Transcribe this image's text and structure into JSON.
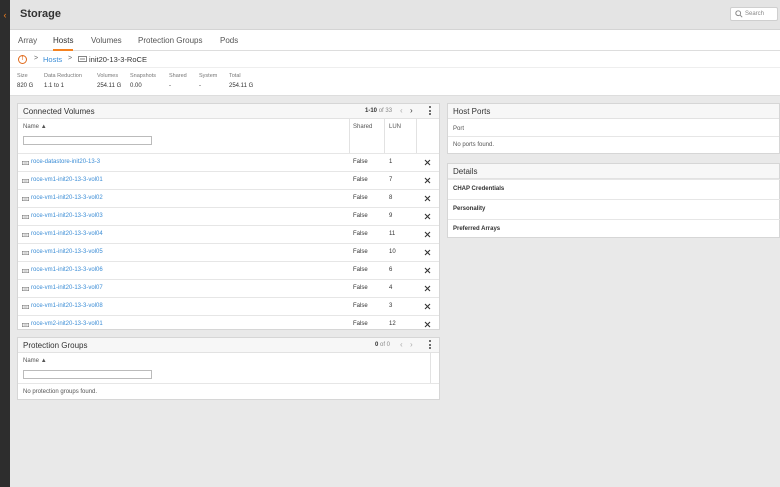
{
  "app": {
    "title": "Storage",
    "search_placeholder": "Search"
  },
  "tabs": [
    "Array",
    "Hosts",
    "Volumes",
    "Protection Groups",
    "Pods"
  ],
  "breadcrumb": {
    "sep": ">",
    "link": "Hosts",
    "current": "init20-13-3-RoCE"
  },
  "stats": [
    {
      "label": "Size",
      "value": "820 G"
    },
    {
      "label": "Data Reduction",
      "value": "1.1 to 1"
    },
    {
      "label": "Volumes",
      "value": "254.11 G"
    },
    {
      "label": "Snapshots",
      "value": "0.00"
    },
    {
      "label": "Shared",
      "value": "-"
    },
    {
      "label": "System",
      "value": "-"
    },
    {
      "label": "Total",
      "value": "254.11 G"
    }
  ],
  "connected_volumes": {
    "title": "Connected Volumes",
    "pager_range": "1-10",
    "pager_total": "of 33",
    "columns": {
      "name": "Name",
      "shared": "Shared",
      "lun": "LUN"
    },
    "rows": [
      {
        "name": "roce-datastore-init20-13-3",
        "shared": "False",
        "lun": "1"
      },
      {
        "name": "roce-vm1-init20-13-3-vol01",
        "shared": "False",
        "lun": "7"
      },
      {
        "name": "roce-vm1-init20-13-3-vol02",
        "shared": "False",
        "lun": "8"
      },
      {
        "name": "roce-vm1-init20-13-3-vol03",
        "shared": "False",
        "lun": "9"
      },
      {
        "name": "roce-vm1-init20-13-3-vol04",
        "shared": "False",
        "lun": "11"
      },
      {
        "name": "roce-vm1-init20-13-3-vol05",
        "shared": "False",
        "lun": "10"
      },
      {
        "name": "roce-vm1-init20-13-3-vol06",
        "shared": "False",
        "lun": "6"
      },
      {
        "name": "roce-vm1-init20-13-3-vol07",
        "shared": "False",
        "lun": "4"
      },
      {
        "name": "roce-vm1-init20-13-3-vol08",
        "shared": "False",
        "lun": "3"
      },
      {
        "name": "roce-vm2-init20-13-3-vol01",
        "shared": "False",
        "lun": "12"
      }
    ]
  },
  "protection_groups": {
    "title": "Protection Groups",
    "pager_range": "0",
    "pager_total": "of 0",
    "columns": {
      "name": "Name"
    },
    "empty": "No protection groups found."
  },
  "host_ports": {
    "title": "Host Ports",
    "columns": {
      "port": "Port"
    },
    "empty": "No ports found."
  },
  "details": {
    "title": "Details",
    "rows": [
      "CHAP Credentials",
      "Personality",
      "Preferred Arrays"
    ]
  },
  "colors": {
    "accent": "#f58220",
    "link": "#3b8dd6"
  }
}
